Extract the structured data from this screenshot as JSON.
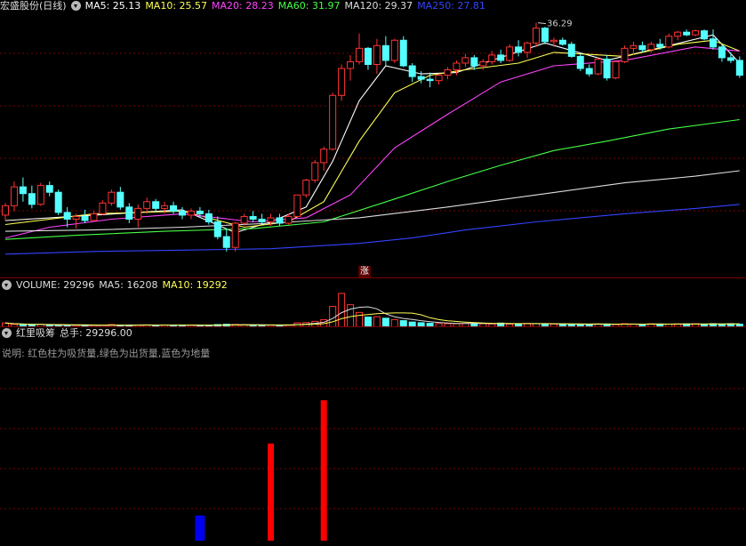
{
  "main_panel": {
    "title": "宏盛股份(日线)",
    "ma": [
      {
        "label": "MA5: 25.13",
        "color": "#ffffff"
      },
      {
        "label": "MA10: 25.57",
        "color": "#ffff55"
      },
      {
        "label": "MA20: 28.23",
        "color": "#ff44ff"
      },
      {
        "label": "MA60: 31.97",
        "color": "#44ff44"
      },
      {
        "label": "MA120: 29.37",
        "color": "#dddddd"
      },
      {
        "label": "MA250: 27.81",
        "color": "#3344ff"
      }
    ],
    "peak_label": "36.29"
  },
  "volume_panel": {
    "items": [
      {
        "label": "VOLUME: 29296",
        "color": "#dddddd"
      },
      {
        "label": "MA5: 16208",
        "color": "#dddddd"
      },
      {
        "label": "MA10: 19292",
        "color": "#ffff55"
      }
    ]
  },
  "indicator_panel": {
    "title": "红里吸筹",
    "total_label": "总手: 29296.00",
    "description": "说明: 红色柱为吸货量,绿色为出货量,蓝色为地量"
  },
  "marker": "涨",
  "colors": {
    "up": "#ff3333",
    "down": "#54ffff",
    "bg": "#000000",
    "grid": "#7a0000"
  },
  "chart_data": [
    {
      "type": "candlestick",
      "ylim": [
        18,
        37.5
      ],
      "ohlc": [
        [
          22.5,
          23.4,
          22.1,
          23.2
        ],
        [
          23.2,
          25.0,
          22.8,
          24.6
        ],
        [
          24.6,
          25.3,
          23.5,
          24.1
        ],
        [
          24.1,
          24.7,
          23.0,
          23.3
        ],
        [
          23.3,
          24.9,
          23.2,
          24.7
        ],
        [
          24.7,
          25.0,
          23.9,
          24.2
        ],
        [
          24.2,
          24.4,
          22.5,
          22.7
        ],
        [
          22.7,
          23.1,
          21.6,
          22.2
        ],
        [
          22.2,
          22.6,
          21.5,
          22.4
        ],
        [
          22.4,
          22.9,
          21.9,
          22.1
        ],
        [
          22.1,
          22.8,
          22.0,
          22.6
        ],
        [
          22.6,
          23.6,
          22.5,
          23.4
        ],
        [
          23.4,
          24.4,
          23.2,
          24.2
        ],
        [
          24.2,
          24.6,
          22.9,
          23.1
        ],
        [
          23.1,
          23.4,
          21.9,
          22.2
        ],
        [
          22.2,
          23.3,
          21.6,
          23.0
        ],
        [
          23.0,
          23.8,
          22.6,
          23.5
        ],
        [
          23.5,
          23.7,
          22.8,
          23.0
        ],
        [
          23.0,
          23.5,
          22.6,
          23.2
        ],
        [
          23.2,
          23.5,
          22.6,
          22.8
        ],
        [
          22.8,
          23.1,
          22.2,
          22.5
        ],
        [
          22.5,
          23.0,
          22.2,
          22.8
        ],
        [
          22.8,
          23.1,
          22.3,
          22.6
        ],
        [
          22.6,
          22.9,
          21.8,
          22.0
        ],
        [
          22.0,
          22.4,
          20.7,
          20.9
        ],
        [
          20.9,
          21.5,
          19.8,
          20.1
        ],
        [
          20.1,
          22.0,
          19.8,
          21.9
        ],
        [
          21.9,
          22.6,
          21.7,
          22.4
        ],
        [
          22.4,
          22.8,
          22.0,
          22.2
        ],
        [
          22.2,
          22.6,
          21.8,
          22.0
        ],
        [
          22.0,
          22.6,
          21.7,
          22.3
        ],
        [
          22.3,
          22.6,
          21.7,
          21.9
        ],
        [
          21.9,
          22.6,
          21.8,
          22.4
        ],
        [
          22.4,
          24.0,
          22.3,
          24.0
        ],
        [
          24.0,
          25.2,
          23.8,
          25.1
        ],
        [
          25.1,
          26.6,
          24.9,
          26.4
        ],
        [
          26.4,
          27.6,
          25.8,
          27.4
        ],
        [
          27.4,
          31.6,
          27.3,
          31.4
        ],
        [
          31.4,
          33.7,
          31.0,
          33.4
        ],
        [
          33.4,
          34.4,
          32.5,
          33.9
        ],
        [
          33.9,
          36.0,
          33.7,
          34.9
        ],
        [
          34.9,
          35.0,
          33.3,
          33.7
        ],
        [
          33.7,
          35.6,
          33.0,
          35.1
        ],
        [
          35.1,
          35.8,
          33.6,
          34.0
        ],
        [
          34.0,
          35.6,
          33.8,
          35.5
        ],
        [
          35.5,
          35.8,
          33.5,
          33.6
        ],
        [
          33.6,
          33.8,
          32.4,
          32.8
        ],
        [
          32.8,
          33.2,
          32.3,
          32.6
        ],
        [
          32.6,
          33.1,
          32.0,
          32.5
        ],
        [
          32.5,
          33.0,
          32.2,
          32.9
        ],
        [
          32.9,
          33.5,
          32.6,
          33.3
        ],
        [
          33.3,
          34.0,
          32.9,
          33.8
        ],
        [
          33.8,
          34.5,
          33.5,
          34.2
        ],
        [
          34.2,
          34.4,
          33.3,
          33.6
        ],
        [
          33.6,
          34.1,
          33.3,
          33.9
        ],
        [
          33.9,
          34.7,
          33.7,
          34.4
        ],
        [
          34.4,
          34.8,
          33.8,
          34.0
        ],
        [
          34.0,
          35.2,
          33.9,
          35.0
        ],
        [
          35.0,
          35.5,
          34.3,
          34.6
        ],
        [
          34.6,
          35.4,
          34.2,
          35.3
        ],
        [
          35.3,
          36.8,
          35.0,
          36.4
        ],
        [
          36.4,
          36.5,
          35.2,
          35.4
        ],
        [
          35.4,
          35.7,
          35.0,
          35.5
        ],
        [
          35.5,
          35.7,
          35.1,
          35.2
        ],
        [
          35.2,
          35.4,
          34.2,
          34.3
        ],
        [
          34.3,
          34.5,
          33.2,
          33.4
        ],
        [
          33.4,
          33.7,
          32.8,
          33.0
        ],
        [
          33.0,
          34.2,
          32.9,
          34.1
        ],
        [
          34.1,
          34.4,
          32.5,
          32.7
        ],
        [
          32.7,
          34.0,
          32.6,
          33.9
        ],
        [
          33.9,
          35.1,
          33.8,
          34.9
        ],
        [
          34.9,
          35.4,
          34.4,
          35.1
        ],
        [
          35.1,
          35.4,
          34.6,
          34.8
        ],
        [
          34.8,
          35.4,
          34.6,
          35.2
        ],
        [
          35.2,
          35.6,
          34.8,
          35.0
        ],
        [
          35.0,
          36.0,
          34.9,
          35.8
        ],
        [
          35.8,
          36.2,
          35.5,
          36.1
        ],
        [
          36.1,
          36.3,
          35.8,
          35.9
        ],
        [
          35.9,
          36.3,
          35.8,
          36.2
        ],
        [
          36.2,
          36.3,
          35.5,
          35.6
        ],
        [
          35.6,
          36.3,
          34.8,
          35.0
        ],
        [
          35.0,
          35.2,
          33.9,
          34.2
        ],
        [
          34.2,
          34.6,
          33.8,
          34.0
        ],
        [
          34.0,
          34.3,
          32.7,
          32.9
        ]
      ],
      "ma_series": {
        "MA5": [
          [
            0,
            22.1
          ],
          [
            10,
            22.5
          ],
          [
            20,
            22.9
          ],
          [
            26,
            21.2
          ],
          [
            30,
            22.0
          ],
          [
            34,
            23.1
          ],
          [
            37,
            26.5
          ],
          [
            40,
            31.0
          ],
          [
            43,
            33.6
          ],
          [
            47,
            33.0
          ],
          [
            51,
            33.1
          ],
          [
            55,
            34.0
          ],
          [
            61,
            35.3
          ],
          [
            68,
            34.0
          ],
          [
            75,
            35.1
          ],
          [
            80,
            35.9
          ],
          [
            83,
            33.8
          ]
        ],
        "MA10": [
          [
            0,
            21.8
          ],
          [
            10,
            22.6
          ],
          [
            20,
            22.8
          ],
          [
            27,
            21.6
          ],
          [
            32,
            22.0
          ],
          [
            36,
            23.5
          ],
          [
            40,
            28.0
          ],
          [
            44,
            31.6
          ],
          [
            48,
            32.9
          ],
          [
            52,
            33.3
          ],
          [
            58,
            33.8
          ],
          [
            62,
            34.6
          ],
          [
            70,
            34.3
          ],
          [
            76,
            35.2
          ],
          [
            80,
            35.5
          ],
          [
            83,
            34.7
          ]
        ],
        "MA20": [
          [
            0,
            20.8
          ],
          [
            5,
            21.6
          ],
          [
            12,
            22.2
          ],
          [
            20,
            22.6
          ],
          [
            28,
            22.0
          ],
          [
            34,
            22.3
          ],
          [
            39,
            24.0
          ],
          [
            44,
            27.5
          ],
          [
            50,
            30.0
          ],
          [
            56,
            32.4
          ],
          [
            62,
            33.6
          ],
          [
            70,
            34.0
          ],
          [
            78,
            35.0
          ],
          [
            83,
            34.7
          ]
        ],
        "MA60": [
          [
            0,
            20.7
          ],
          [
            8,
            21.0
          ],
          [
            18,
            21.3
          ],
          [
            28,
            21.5
          ],
          [
            36,
            22.0
          ],
          [
            44,
            23.7
          ],
          [
            50,
            25.0
          ],
          [
            56,
            26.2
          ],
          [
            62,
            27.3
          ],
          [
            68,
            28.0
          ],
          [
            75,
            28.9
          ],
          [
            83,
            29.6
          ]
        ],
        "MA120": [
          [
            0,
            21.3
          ],
          [
            10,
            21.4
          ],
          [
            20,
            21.6
          ],
          [
            30,
            21.9
          ],
          [
            40,
            22.3
          ],
          [
            50,
            23.1
          ],
          [
            60,
            24.0
          ],
          [
            70,
            24.9
          ],
          [
            78,
            25.4
          ],
          [
            83,
            25.8
          ]
        ],
        "MA250": [
          [
            0,
            19.6
          ],
          [
            10,
            19.8
          ],
          [
            20,
            19.9
          ],
          [
            30,
            20.0
          ],
          [
            40,
            20.4
          ],
          [
            46,
            20.8
          ],
          [
            52,
            21.4
          ],
          [
            60,
            22.0
          ],
          [
            70,
            22.6
          ],
          [
            78,
            23.0
          ],
          [
            83,
            23.3
          ]
        ]
      }
    },
    {
      "type": "bar",
      "name": "VOLUME",
      "ylim": [
        0,
        30000
      ],
      "values": [
        3700,
        2400,
        2100,
        2000,
        2400,
        1900,
        1700,
        1600,
        1500,
        1700,
        1600,
        1800,
        2300,
        1900,
        1900,
        1900,
        2000,
        1900,
        1800,
        1800,
        1700,
        1800,
        1700,
        1800,
        2300,
        2600,
        2400,
        2100,
        1800,
        1700,
        1700,
        1800,
        2000,
        3800,
        4100,
        5100,
        6600,
        18000,
        29296,
        19500,
        12800,
        8800,
        9100,
        7800,
        6600,
        5700,
        4500,
        3900,
        3400,
        3200,
        3100,
        3000,
        3300,
        3600,
        3100,
        2800,
        3600,
        2700,
        3000,
        3300,
        3100,
        2900,
        2700,
        2600,
        2700,
        2600,
        2400,
        2800,
        2800,
        2300,
        3100,
        2700,
        2600,
        3000,
        2700,
        2600,
        2800,
        2900,
        3000,
        2600,
        3100,
        2700,
        3100,
        2700
      ]
    },
    {
      "type": "bar",
      "name": "红里吸筹",
      "ylim": [
        0,
        4.2
      ],
      "bars": [
        {
          "index": 22,
          "value": 0.7,
          "color": "#0000ee"
        },
        {
          "index": 30,
          "value": 2.7,
          "color": "#ff0000"
        },
        {
          "index": 36,
          "value": 3.9,
          "color": "#ff0000"
        }
      ]
    }
  ]
}
